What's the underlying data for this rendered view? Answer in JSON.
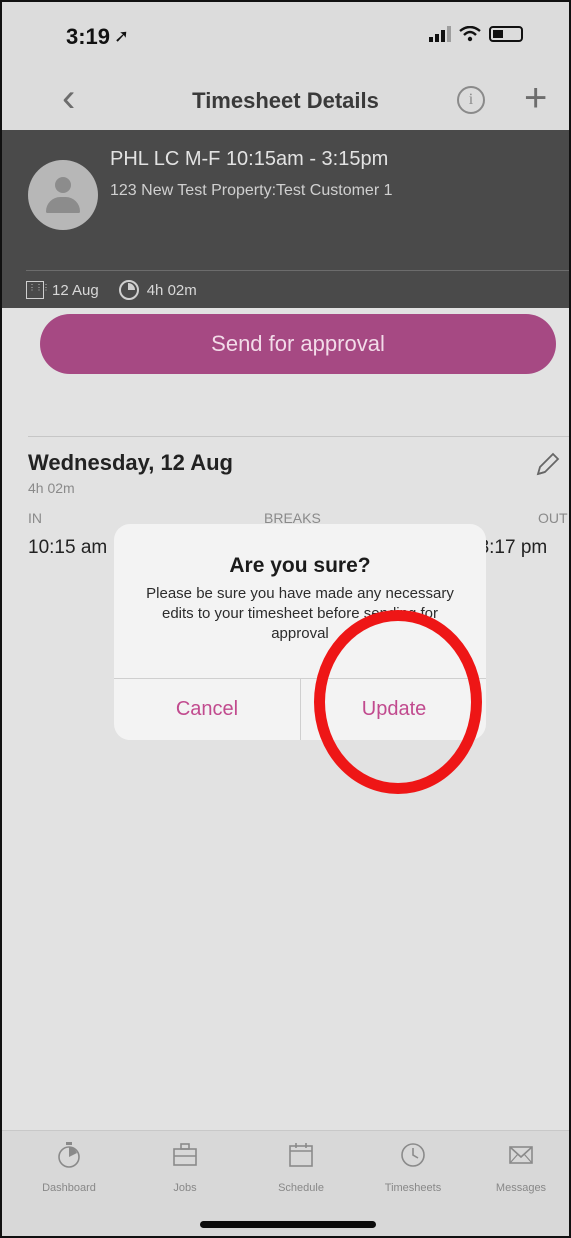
{
  "status": {
    "time": "3:19",
    "location_glyph": "➚"
  },
  "nav": {
    "title": "Timesheet Details",
    "info_glyph": "i"
  },
  "job": {
    "title": "PHL LC M-F 10:15am - 3:15pm",
    "subtitle": "123 New Test Property:Test Customer 1",
    "date": "12 Aug",
    "duration": "4h 02m"
  },
  "send_button": "Send for approval",
  "day": {
    "name": "Wednesday, 12 Aug",
    "hours": "4h 02m",
    "in_label": "IN",
    "breaks_label": "BREAKS",
    "out_label": "OUT",
    "in_value": "10:15 am",
    "out_value": "03:17 pm"
  },
  "dialog": {
    "title": "Are you sure?",
    "message": "Please be sure you have made any necessary edits to your timesheet before sending for approval",
    "cancel": "Cancel",
    "update": "Update"
  },
  "tabs": [
    {
      "label": "Dashboard",
      "icon": "stopwatch-icon"
    },
    {
      "label": "Jobs",
      "icon": "briefcase-icon"
    },
    {
      "label": "Schedule",
      "icon": "calendar-icon"
    },
    {
      "label": "Timesheets",
      "icon": "clock-icon"
    },
    {
      "label": "Messages",
      "icon": "envelope-icon"
    }
  ],
  "colors": {
    "accent": "#a64983",
    "dialog_button": "#c14a8e",
    "annotation_circle": "#ee1616",
    "header_dark": "#4a4a4a"
  }
}
